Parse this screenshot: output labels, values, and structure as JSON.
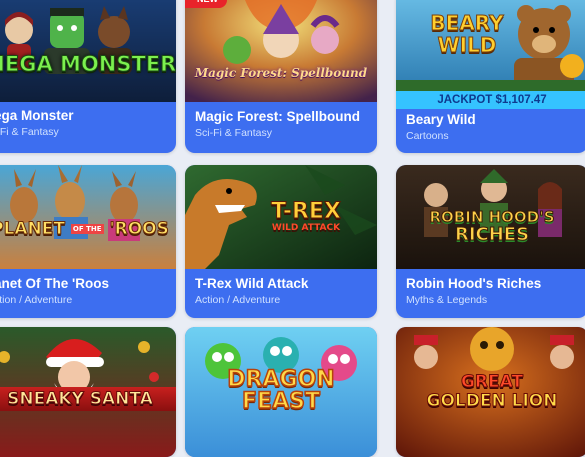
{
  "games": [
    {
      "title": "ega Monster",
      "category": "i-Fi & Fantasy",
      "logo": "MEGA MONSTER"
    },
    {
      "title": "Magic Forest: Spellbound",
      "category": "Sci-Fi & Fantasy",
      "badge": "NEW",
      "logo": "Magic Forest: Spellbound"
    },
    {
      "title": "Beary Wild",
      "category": "Cartoons",
      "jackpot": "JACKPOT $1,107.47",
      "logo_line1": "BEARY",
      "logo_line2": "WILD"
    },
    {
      "title": "anet Of The 'Roos",
      "category": "ction / Adventure",
      "logo": "PLANET",
      "logo_small": "OF THE",
      "logo_end": "'ROOS"
    },
    {
      "title": "T-Rex Wild Attack",
      "category": "Action / Adventure",
      "logo_line1": "T-REX",
      "logo_line2": "WILD ATTACK"
    },
    {
      "title": "Robin Hood's Riches",
      "category": "Myths & Legends",
      "logo_line1": "ROBIN HOOD'S",
      "logo_line2": "RICHES"
    },
    {
      "logo": "SNEAKY SANTA"
    },
    {
      "logo_line1": "DRAGON",
      "logo_line2": "FEAST"
    },
    {
      "logo_line1": "GREAT",
      "logo_line2": "GOLDEN LION"
    }
  ],
  "colors": {
    "card_blue": "#3d6ef0",
    "category_text": "#cfe0ff",
    "jackpot_bar": "#35c3ff",
    "new_badge": "#e8232a",
    "page_bg": "#e9edf5"
  }
}
